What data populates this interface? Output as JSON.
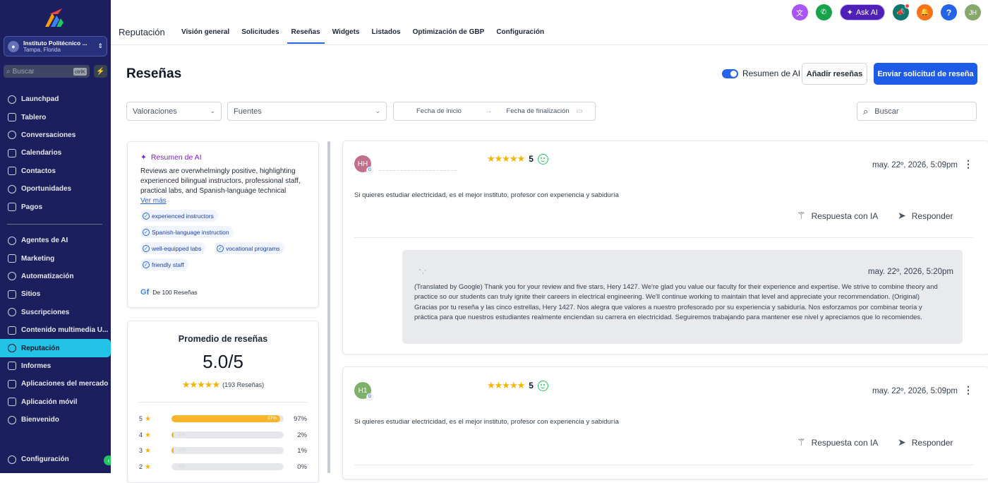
{
  "sidebar": {
    "location": {
      "name": "Instituto Politécnico ...",
      "city": "Tampa, Florida"
    },
    "search": {
      "placeholder": "Buscar",
      "shortcut": "ctrlK"
    },
    "items_top": [
      {
        "label": "Launchpad",
        "icon": "launchpad-icon"
      },
      {
        "label": "Tablero",
        "icon": "dashboard-icon"
      },
      {
        "label": "Conversaciones",
        "icon": "chat-icon"
      },
      {
        "label": "Calendarios",
        "icon": "calendar-icon"
      },
      {
        "label": "Contactos",
        "icon": "contacts-icon"
      },
      {
        "label": "Oportunidades",
        "icon": "opportunities-icon"
      },
      {
        "label": "Pagos",
        "icon": "payments-icon"
      }
    ],
    "items_bottom": [
      {
        "label": "Agentes de AI",
        "icon": "ai-agents-icon"
      },
      {
        "label": "Marketing",
        "icon": "marketing-icon"
      },
      {
        "label": "Automatización",
        "icon": "automation-icon"
      },
      {
        "label": "Sitios",
        "icon": "sites-icon"
      },
      {
        "label": "Suscripciones",
        "icon": "subscriptions-icon"
      },
      {
        "label": "Contenido multimedia U...",
        "icon": "media-icon"
      },
      {
        "label": "Reputación",
        "icon": "star-icon",
        "active": true
      },
      {
        "label": "Informes",
        "icon": "reports-icon"
      },
      {
        "label": "Aplicaciones del mercado",
        "icon": "apps-icon"
      },
      {
        "label": "Aplicación móvil",
        "icon": "mobile-icon"
      },
      {
        "label": "Bienvenido",
        "icon": "info-icon"
      }
    ],
    "settings": "Configuración"
  },
  "topbar": {
    "module": "Reputación",
    "tabs": [
      "Visión general",
      "Solicitudes",
      "Reseñas",
      "Widgets",
      "Listados",
      "Optimización de GBP",
      "Configuración"
    ],
    "active_tab": "Reseñas",
    "ask_ai": "Ask AI",
    "user_initials": "JH"
  },
  "page": {
    "title": "Reseñas",
    "ai_summary_toggle": "Resumen de AI",
    "add_reviews": "Añadir reseñas",
    "send_request": "Enviar solicitud de reseña",
    "filters": {
      "ratings": "Valoraciones",
      "sources": "Fuentes",
      "start_date": "Fecha de inicio",
      "end_date": "Fecha de finalización",
      "search_placeholder": "Buscar"
    }
  },
  "ai_summary": {
    "heading": "Resumen de AI",
    "text": "Reviews are overwhelmingly positive, highlighting experienced bilingual instructors, professional staff, practical labs, and Spanish-language technical",
    "more": "Ver más",
    "tags": [
      "experienced instructors",
      "Spanish-language instruction",
      "well-equipped labs",
      "vocational programs",
      "friendly staff"
    ],
    "source_text": "De 100 Reseñas"
  },
  "average": {
    "title": "Promedio de reseñas",
    "value": "5.0/5",
    "count": "(193 Reseñas)",
    "rows": [
      {
        "stars": "5",
        "percent": "97%",
        "fill": 0.97
      },
      {
        "stars": "4",
        "percent": "2%",
        "fill": 0.02
      },
      {
        "stars": "3",
        "percent": "1%",
        "fill": 0.01
      },
      {
        "stars": "2",
        "percent": "0%",
        "fill": 0.0
      }
    ]
  },
  "reviews": [
    {
      "initials": "HH",
      "avatar_color": "#c0708a",
      "rating": "5",
      "date": "may. 22º, 2026, 5:09pm",
      "text": "Si quieres estudiar electricidad, es el mejor instituto, profesor con experiencia y sabiduría",
      "ai_reply": "Respuesta con IA",
      "reply": "Responder",
      "response": {
        "date": "may. 22º, 2026, 5:20pm",
        "text": "(Translated by Google) Thank you for your review and five stars, Hery 1427. We're glad you value our faculty for their experience and expertise. We strive to combine theory and practice so our students can truly ignite their careers in electrical engineering. We'll continue working to maintain that level and appreciate your recommendation. (Original) Gracias por tu reseña y las cinco estrellas, Hery 1427. Nos alegra que valores a nuestro profesorado por su experiencia y sabiduría. Nos esforzamos por combinar teoría y práctica para que nuestros estudiantes realmente enciendan su carrera en electricidad. Seguiremos trabajando para mantener ese nivel y apreciamos que lo recomiendes."
      }
    },
    {
      "initials": "H1",
      "avatar_color": "#7fb069",
      "rating": "5",
      "date": "may. 22º, 2026, 5:09pm",
      "text": "Si quieres estudiar electricidad, es el mejor instituto, profesor con experiencia y sabiduría",
      "ai_reply": "Respuesta con IA",
      "reply": "Responder"
    }
  ]
}
